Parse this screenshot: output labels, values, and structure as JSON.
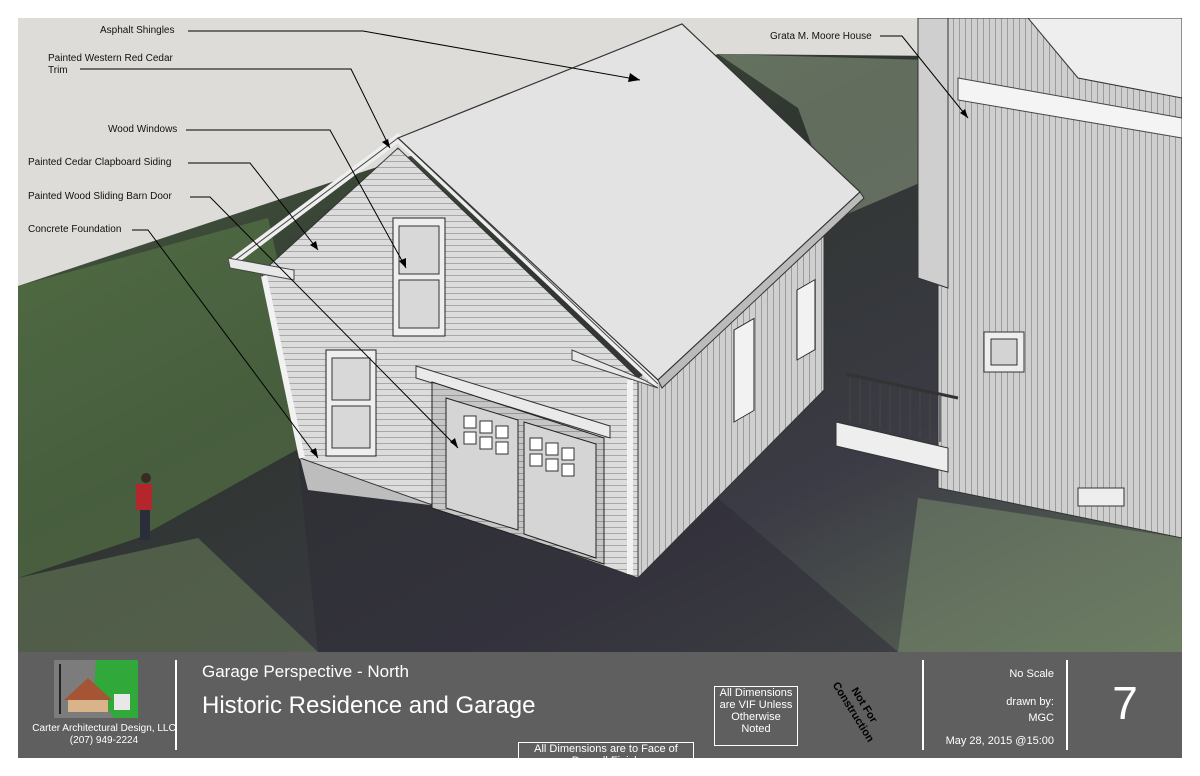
{
  "callouts": {
    "asphalt_shingles": "Asphalt Shingles",
    "cedar_trim_line1": "Painted Western Red Cedar",
    "cedar_trim_line2": "Trim",
    "wood_windows": "Wood Windows",
    "clapboard_siding": "Painted Cedar Clapboard Siding",
    "barn_door": "Painted Wood Sliding Barn Door",
    "foundation": "Concrete Foundation",
    "moore_house": "Grata M. Moore House"
  },
  "title_block": {
    "company": "Carter Architectural Design, LLC",
    "phone": "(207) 949-2224",
    "sheet_subtitle": "Garage Perspective - North",
    "project_title": "Historic Residence and Garage",
    "note_drywall": "All Dimensions are to Face of Drywall Finish",
    "note_vif_1": "All Dimensions",
    "note_vif_2": "are VIF Unless",
    "note_vif_3": "Otherwise",
    "note_vif_4": "Noted",
    "stamp_1": "Not For",
    "stamp_2": "Construction",
    "scale": "No Scale",
    "drawn_by_label": "drawn by:",
    "drawn_by": "MGC",
    "date": "May 28, 2015 @15:00",
    "sheet_number": "7"
  },
  "colors": {
    "title_block_bg": "#5f5f5f",
    "ground_dark": "#3a3f3a",
    "ground_green": "#5b7048",
    "wall": "#d9d9d9",
    "roof": "#e4e4e4",
    "accent_logo": "#31a83a"
  }
}
